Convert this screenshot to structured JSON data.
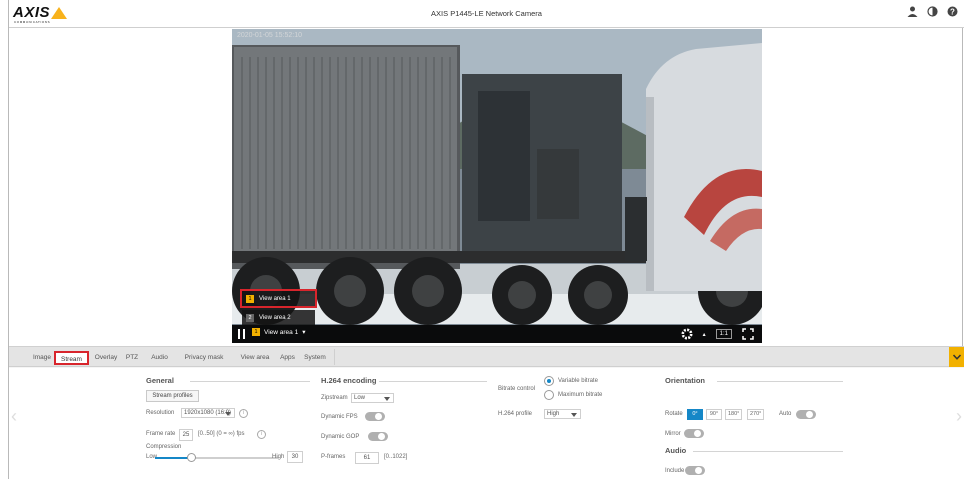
{
  "header": {
    "logo_text": "AXIS",
    "logo_subtext": "COMMUNICATIONS",
    "title": "AXIS P1445-LE Network Camera"
  },
  "video": {
    "timestamp": "2020-01-05 15:52:10",
    "view_areas": [
      {
        "num": "1",
        "label": "View area 1"
      },
      {
        "num": "2",
        "label": "View area 2"
      }
    ],
    "current_view": {
      "num": "1",
      "label": "View area 1"
    },
    "ratio": "1:1"
  },
  "tabs": [
    "Image",
    "Stream",
    "Overlay",
    "PTZ",
    "Audio",
    "Privacy mask",
    "View area",
    "Apps",
    "System"
  ],
  "general": {
    "title": "General",
    "stream_profiles_label": "Stream profiles",
    "resolution_label": "Resolution",
    "resolution_value": "1920x1080 (16:9)",
    "frame_rate_label": "Frame rate",
    "frame_rate_value": "25",
    "frame_rate_hint": "[0..50] (0 = ∞) fps",
    "compression_label": "Compression",
    "compression_low": "Low",
    "compression_high": "High",
    "compression_value": "30",
    "compression_level": 0.3
  },
  "h264": {
    "title": "H.264 encoding",
    "zipstream_label": "Zipstream",
    "zipstream_value": "Low",
    "dynamic_fps_label": "Dynamic FPS",
    "dynamic_gop_label": "Dynamic GOP",
    "pframes_label": "P-frames",
    "pframes_value": "61",
    "pframes_hint": "[0..1022]",
    "bitrate_label": "Bitrate control",
    "variable_bitrate": "Variable bitrate",
    "maximum_bitrate": "Maximum bitrate",
    "profile_label": "H.264 profile",
    "profile_value": "High"
  },
  "orientation": {
    "title": "Orientation",
    "rotate_label": "Rotate",
    "rotations": [
      "0°",
      "90°",
      "180°",
      "270°"
    ],
    "auto_label": "Auto",
    "mirror_label": "Mirror"
  },
  "audio": {
    "title": "Audio",
    "include_label": "Include"
  }
}
